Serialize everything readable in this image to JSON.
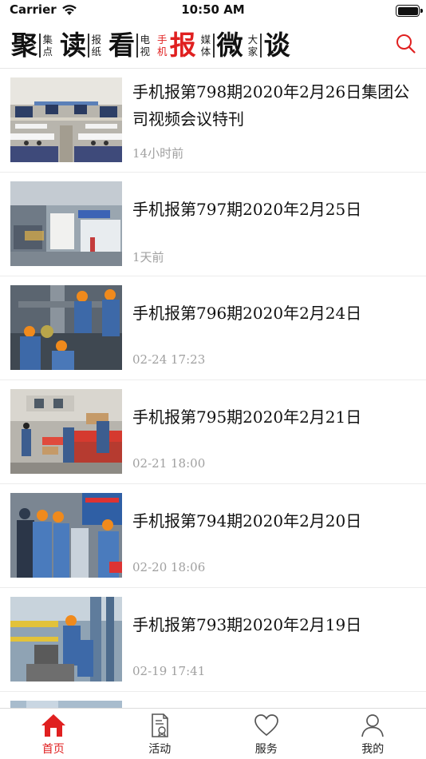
{
  "status_bar": {
    "carrier": "Carrier",
    "time": "10:50 AM"
  },
  "channels": [
    {
      "big": "聚",
      "small": [
        "集",
        "点"
      ],
      "active": false,
      "pre": false
    },
    {
      "big": "读",
      "small": [
        "报",
        "纸"
      ],
      "active": false,
      "pre": false
    },
    {
      "big": "看",
      "small": [
        "电",
        "视"
      ],
      "active": false,
      "pre": false
    },
    {
      "big": "报",
      "small": [
        "手",
        "机"
      ],
      "active": true,
      "pre": true
    },
    {
      "big": "微",
      "small": [
        "媒",
        "体"
      ],
      "active": false,
      "pre": true
    },
    {
      "big": "谈",
      "small": [
        "大",
        "家"
      ],
      "active": false,
      "pre": true
    }
  ],
  "news": [
    {
      "title": "手机报第798期2020年2月26日集团公司视频会议特刊",
      "time": "14小时前",
      "image": "meeting-photo"
    },
    {
      "title": "手机报第797期2020年2月25日",
      "time": "1天前",
      "image": "warehouse-forklift-photo"
    },
    {
      "title": "手机报第796期2020年2月24日",
      "time": "02-24 17:23",
      "image": "workers-pipes-photo"
    },
    {
      "title": "手机报第795期2020年2月21日",
      "time": "02-21 18:00",
      "image": "truck-unloading-photo"
    },
    {
      "title": "手机报第794期2020年2月20日",
      "time": "02-20 18:06",
      "image": "safety-inspection-photo"
    },
    {
      "title": "手机报第793期2020年2月19日",
      "time": "02-19 17:41",
      "image": "workers-valve-photo"
    }
  ],
  "tabs": [
    {
      "label": "首页",
      "icon": "home-icon",
      "active": true
    },
    {
      "label": "活动",
      "icon": "activity-document-icon",
      "active": false
    },
    {
      "label": "服务",
      "icon": "heart-icon",
      "active": false
    },
    {
      "label": "我的",
      "icon": "user-icon",
      "active": false
    }
  ],
  "colors": {
    "accent": "#e02020",
    "meta_text": "#a0a0a0",
    "divider": "#ececec"
  }
}
